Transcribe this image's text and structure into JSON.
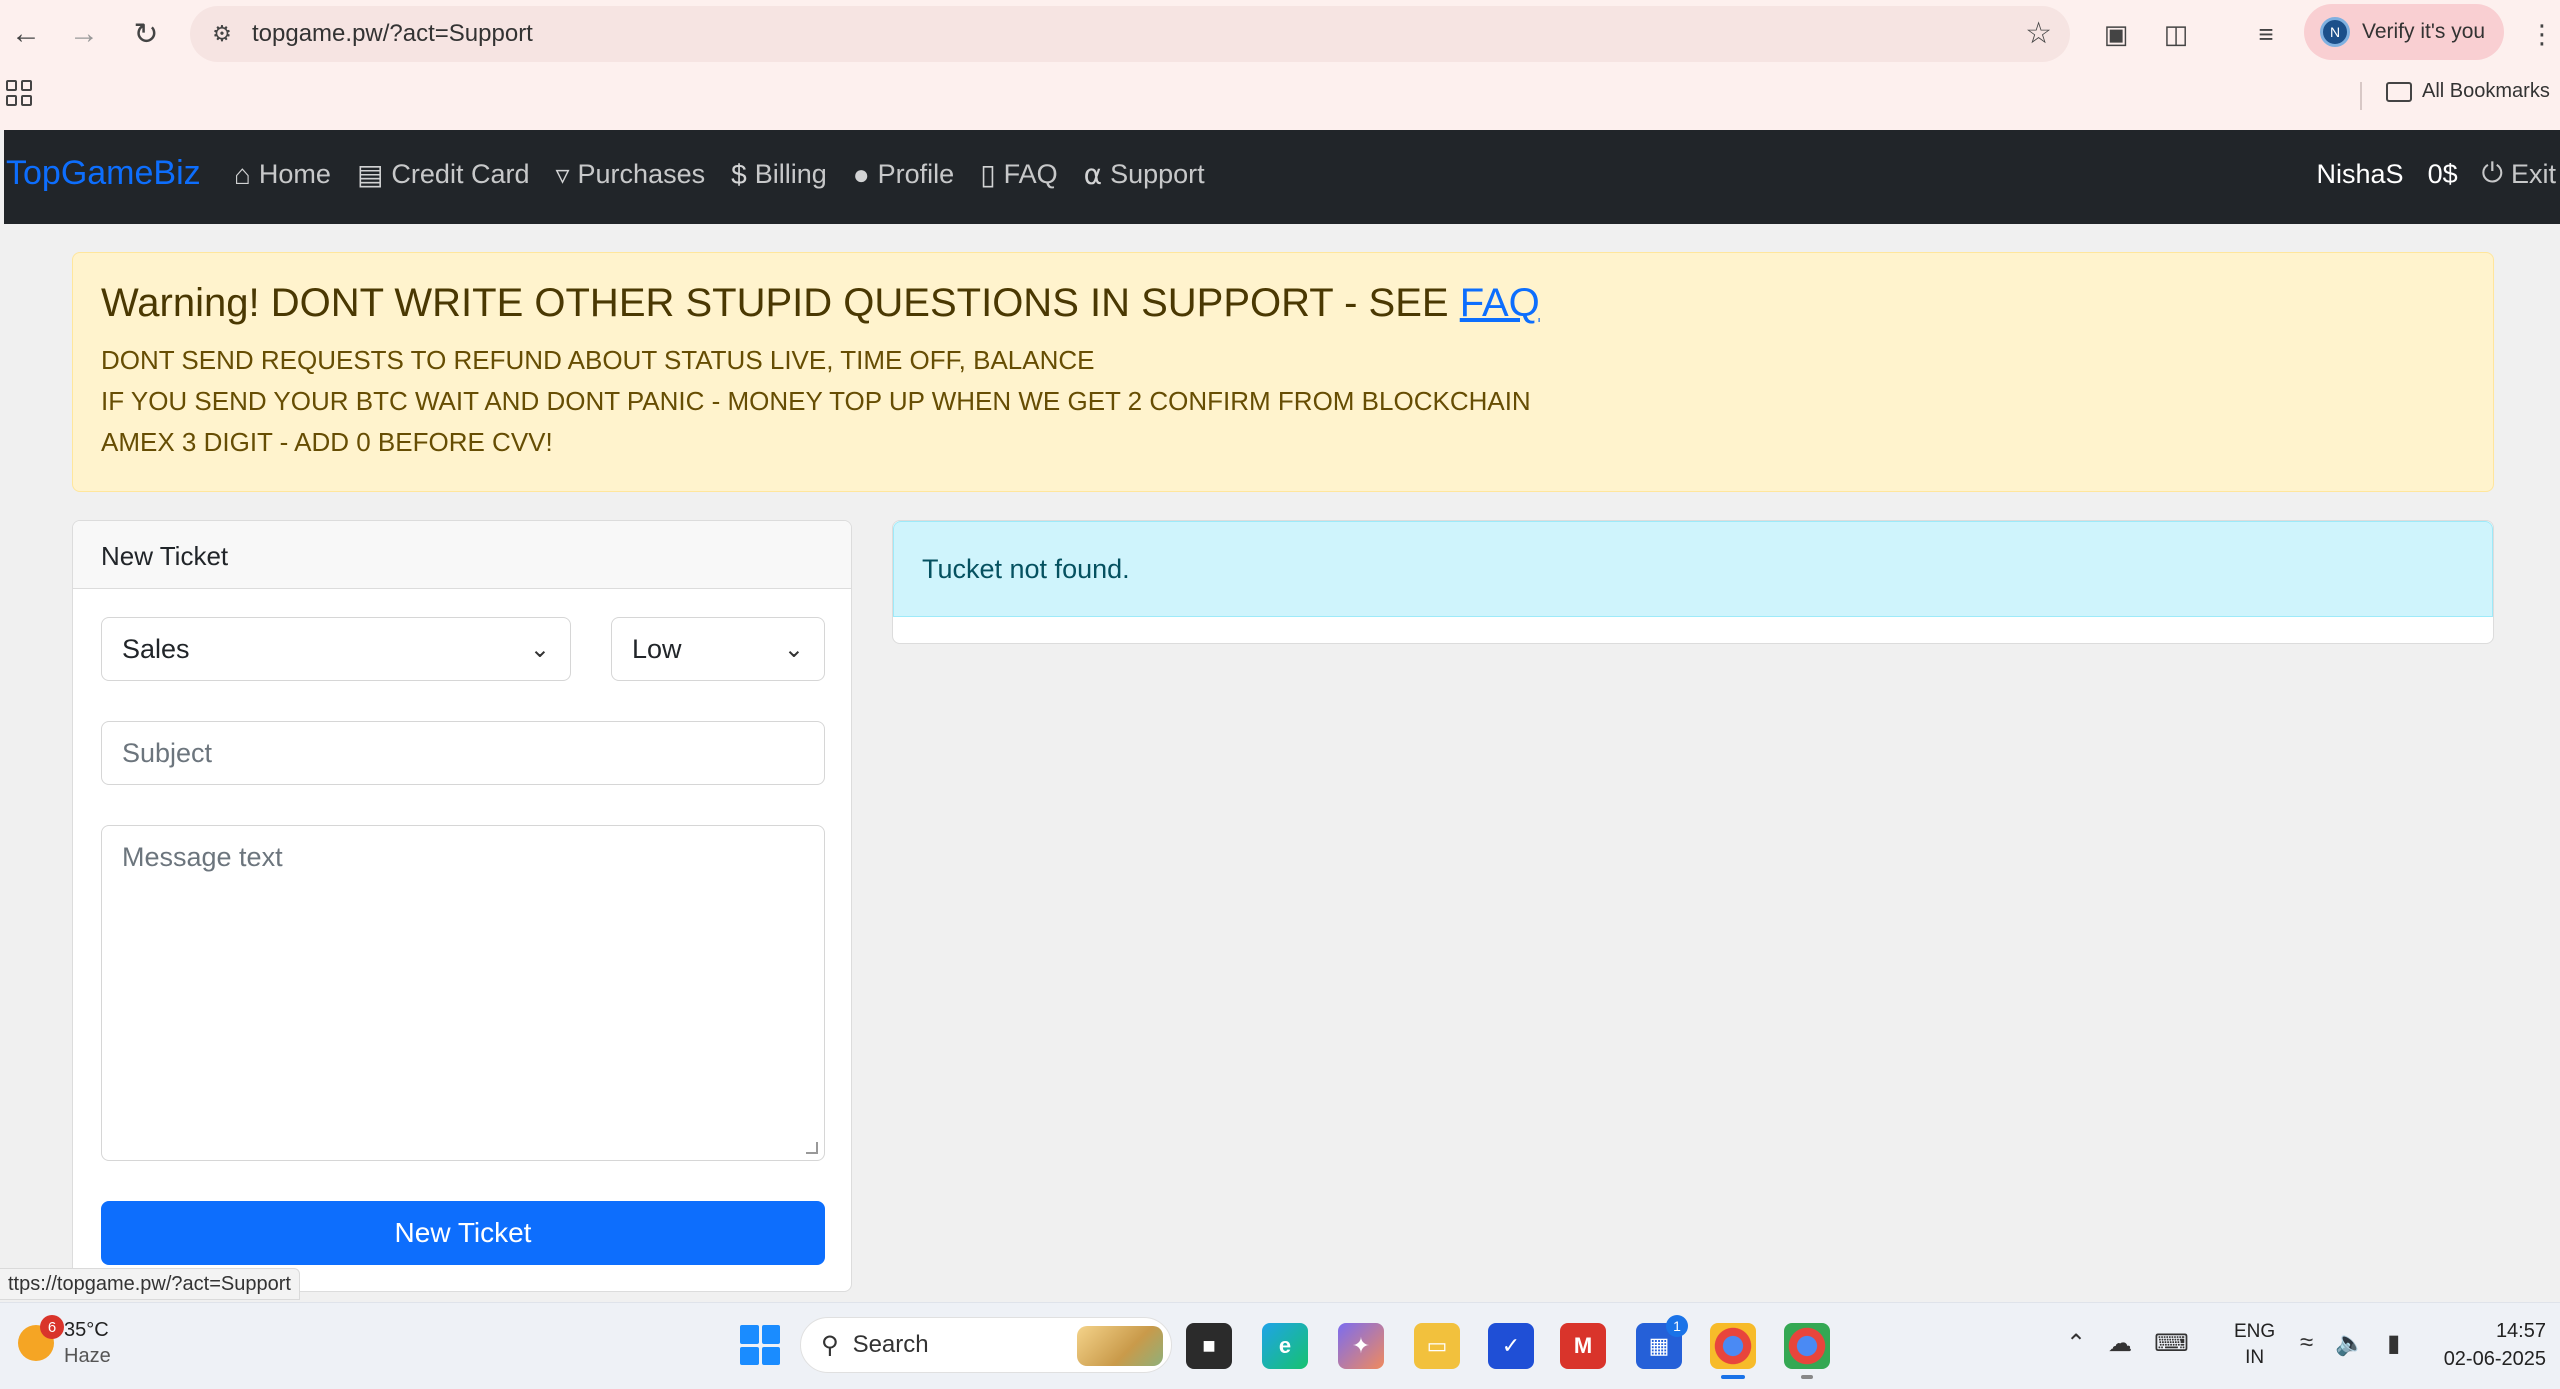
{
  "browser": {
    "url": "topgame.pw/?act=Support",
    "verify_label": "Verify it's you",
    "profile_initial": "N",
    "all_bookmarks": "All Bookmarks"
  },
  "navbar": {
    "brand": "TopGameBiz",
    "links": [
      {
        "label": "Home",
        "icon": "home-icon"
      },
      {
        "label": "Credit Card",
        "icon": "credit-card-icon"
      },
      {
        "label": "Purchases",
        "icon": "cart-icon"
      },
      {
        "label": "Billing",
        "icon": "dollar-icon"
      },
      {
        "label": "Profile",
        "icon": "user-icon"
      },
      {
        "label": "FAQ",
        "icon": "book-icon"
      },
      {
        "label": "Support",
        "icon": "headphones-icon"
      }
    ],
    "username": "NishaS",
    "balance": "0$",
    "exit": "Exit"
  },
  "warning": {
    "title_prefix": "Warning! DONT WRITE OTHER STUPID QUESTIONS IN SUPPORT - SEE ",
    "title_link": "FAQ",
    "lines": [
      "DONT SEND REQUESTS TO REFUND ABOUT STATUS LIVE, TIME OFF, BALANCE",
      "IF YOU SEND YOUR BTC WAIT AND DONT PANIC - MONEY TOP UP WHEN WE GET 2 CONFIRM FROM BLOCKCHAIN",
      "AMEX 3 DIGIT - ADD 0 BEFORE CVV!"
    ]
  },
  "ticket_form": {
    "header": "New Ticket",
    "department": "Sales",
    "priority": "Low",
    "subject_placeholder": "Subject",
    "message_placeholder": "Message text",
    "submit": "New Ticket"
  },
  "tickets": {
    "empty_message": "Tucket not found."
  },
  "status_url": "ttps://topgame.pw/?act=Support",
  "taskbar": {
    "weather_temp": "35°C",
    "weather_desc": "Haze",
    "weather_badge": "6",
    "search_label": "Search",
    "store_badge": "1",
    "lang_line1": "ENG",
    "lang_line2": "IN",
    "time": "14:57",
    "date": "02-06-2025"
  }
}
